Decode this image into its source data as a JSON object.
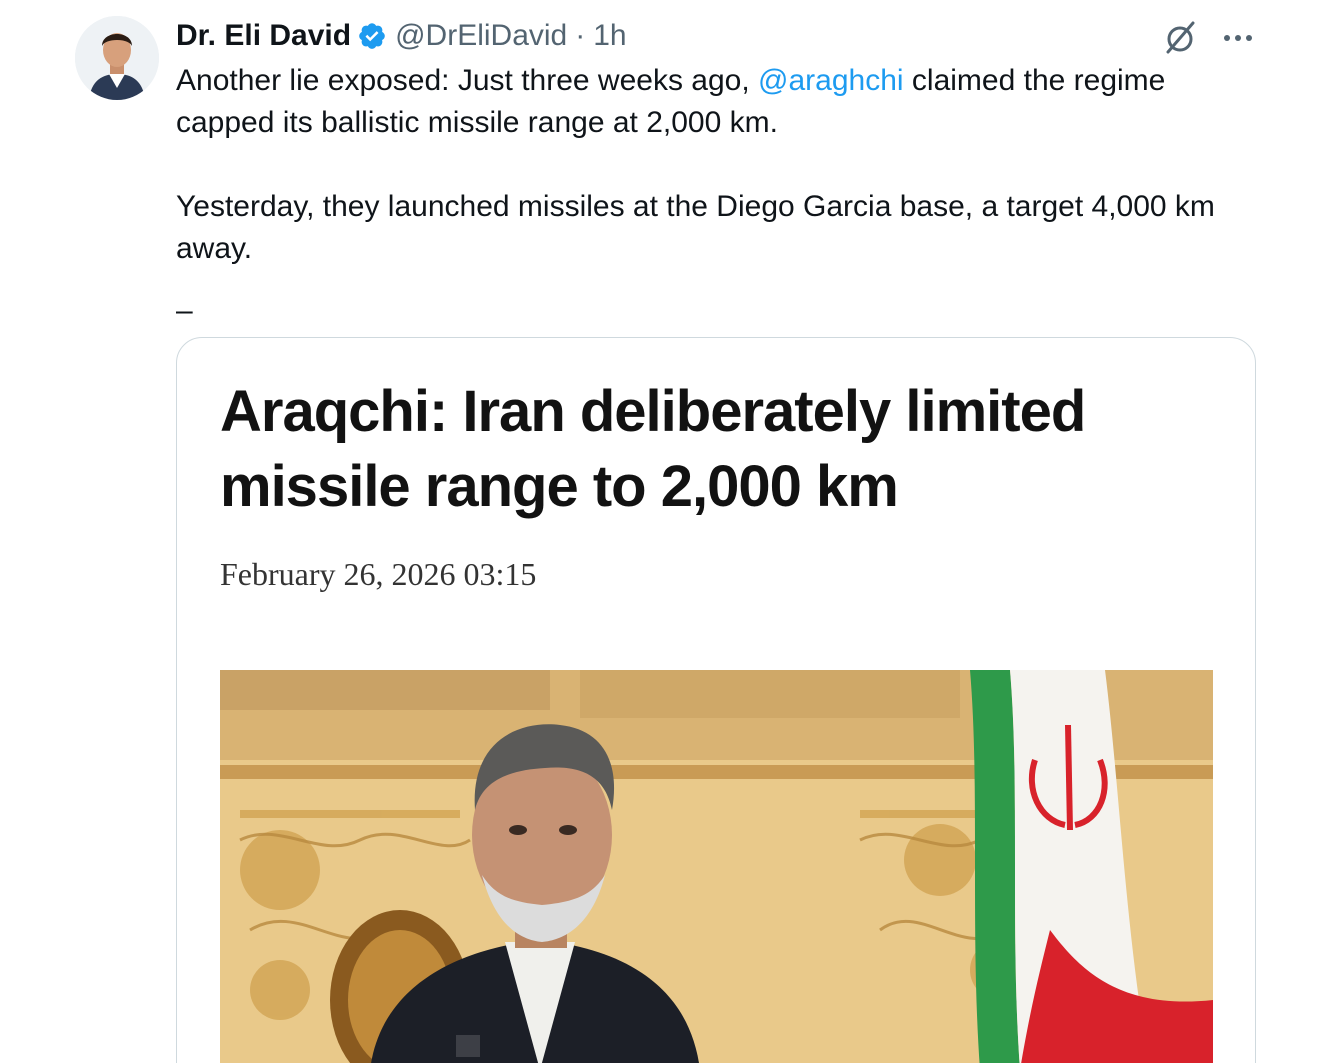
{
  "author": {
    "display_name": "Dr. Eli David",
    "handle": "@DrEliDavid",
    "separator": "·",
    "time": "1h",
    "verified": true
  },
  "tweet": {
    "line1_before": "Another lie exposed: Just three weeks ago, ",
    "mention": "@araghchi",
    "line1_after": " claimed the regime capped its ballistic missile range at 2,000 km.",
    "paragraph2": "Yesterday, they launched missiles at the Diego Garcia base, a target 4,000 km away.",
    "paragraph3": "–"
  },
  "card": {
    "headline": "Araqchi: Iran deliberately limited missile range to 2,000 km",
    "date": "February 26, 2026 03:15"
  },
  "icons": {
    "verified": "verified-badge-icon",
    "grok": "grok-icon",
    "more": "more-options-icon"
  },
  "colors": {
    "text": "#0f1419",
    "secondary": "#536471",
    "link": "#1d9bf0",
    "verified": "#1d9bf0",
    "border": "#cfd9de"
  }
}
